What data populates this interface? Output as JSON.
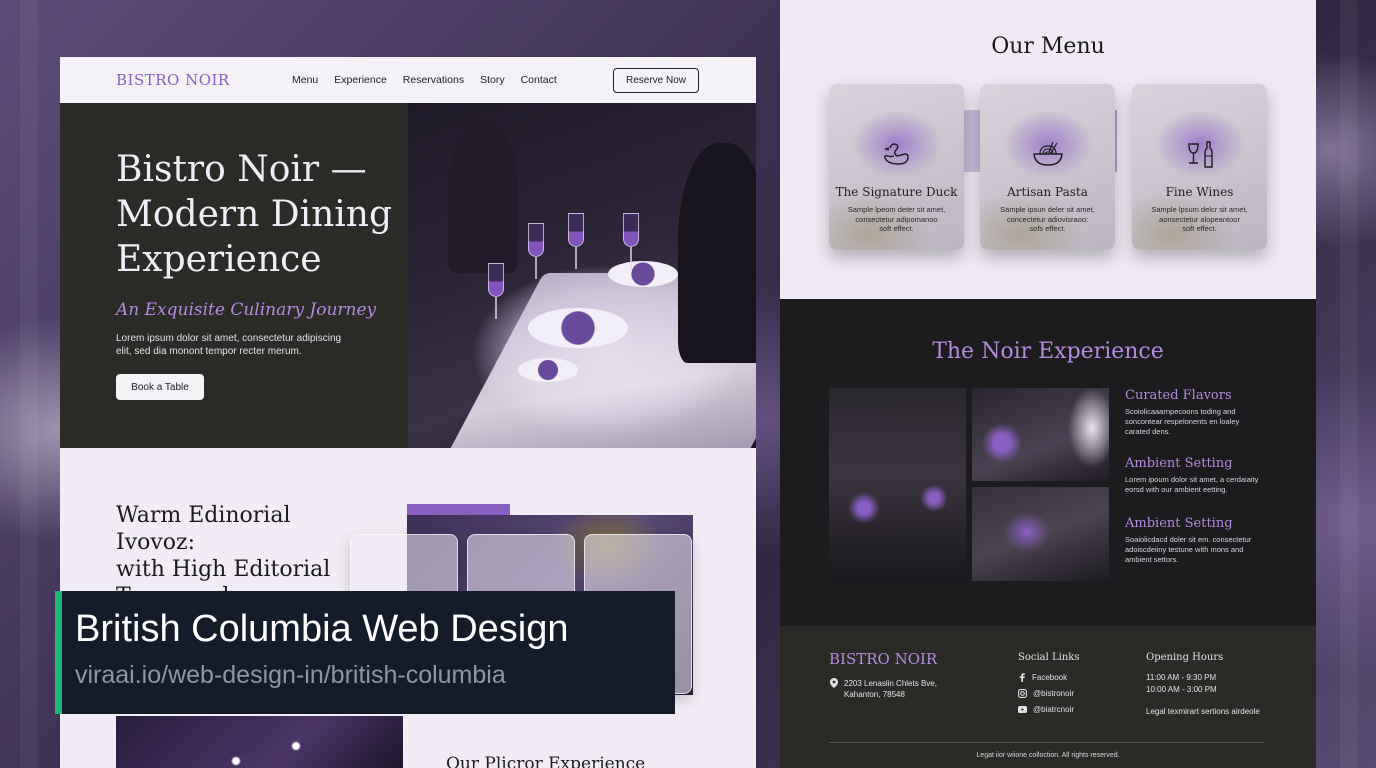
{
  "left_page": {
    "brand": "BISTRO NOIR",
    "nav_links": [
      "Menu",
      "Experience",
      "Reservations",
      "Story",
      "Contact"
    ],
    "reserve_button": "Reserve Now",
    "hero": {
      "title_lines": [
        "Bistro Noir —",
        "Modern Dining",
        "Experience"
      ],
      "subtitle": "An Exquisite Culinary Journey",
      "body_lines": [
        "Lorem ipsum dolor sit amet, consectetur adipiscing",
        "elit, sed dia monont tempor recter merum."
      ],
      "cta": "Book a Table"
    },
    "section2": {
      "title_lines": [
        "Warm Edinorial Ivovoz:",
        "with High Editorial",
        "Typography"
      ]
    },
    "section3_title": "Our Plicror Experience"
  },
  "right_page": {
    "menu": {
      "title": "Our Menu",
      "items": [
        {
          "title": "The Signature Duck",
          "desc_lines": [
            "Sample lpeom deter sit amet,",
            "consectetur adipomanoo",
            "soft effect."
          ],
          "icon": "duck-icon"
        },
        {
          "title": "Artisan Pasta",
          "desc_lines": [
            "Sample ipsun deler sit amet,",
            "concectetur adiovisraoo:",
            "sofs effect."
          ],
          "icon": "pasta-bowl-icon"
        },
        {
          "title": "Fine Wines",
          "desc_lines": [
            "Sample lpsum delcr sit amet,",
            "aonsectetur alopeantoor",
            "soft effect."
          ],
          "icon": "wine-icon"
        }
      ]
    },
    "experience": {
      "title": "The Noir Experience",
      "items": [
        {
          "title": "Curated Flavors",
          "desc_lines": [
            "Scoiolicaaarnpecoons toding and",
            "soncontear respelonents en loaley",
            "carated dens."
          ]
        },
        {
          "title": "Ambient Setting",
          "desc_lines": [
            "Lorem ipoum dolor sit amet, a cerdaiaity",
            "eorsd with our ambient eetting."
          ]
        },
        {
          "title": "Ambient Setting",
          "desc_lines": [
            "Soaiolicdacd doler sit em. consectetur",
            "adoiscdeiiny testune with mons and",
            "ambient settors."
          ]
        }
      ]
    },
    "footer": {
      "brand": "BISTRO NOIR",
      "address_lines": [
        "2203 Lenaslin Chlets Bve,",
        "Kahanton, 78548"
      ],
      "social_title": "Social Links",
      "social_links": [
        {
          "label": "Facebook",
          "icon": "facebook-icon"
        },
        {
          "label": "@bistronoir",
          "icon": "instagram-icon"
        },
        {
          "label": "@biatrcnoir",
          "icon": "youtube-icon"
        }
      ],
      "hours_title": "Opening Hours",
      "hours_lines": [
        "11:00 AM - 9:30 PM",
        "10:00 AM - 3:00 PM"
      ],
      "legal_line": "Legal texmirart sertions airdeole",
      "copyright": "Legat iior wiione colloction. All rights reserved."
    }
  },
  "caption": {
    "title": "British Columbia Web Design",
    "url": "viraai.io/web-design-in/british-columbia"
  },
  "colors": {
    "accent_purple": "#b48ae0",
    "brand_purple": "#8a5fc2",
    "caption_bar": "#1fb37a",
    "caption_bg": "#141c2a"
  }
}
